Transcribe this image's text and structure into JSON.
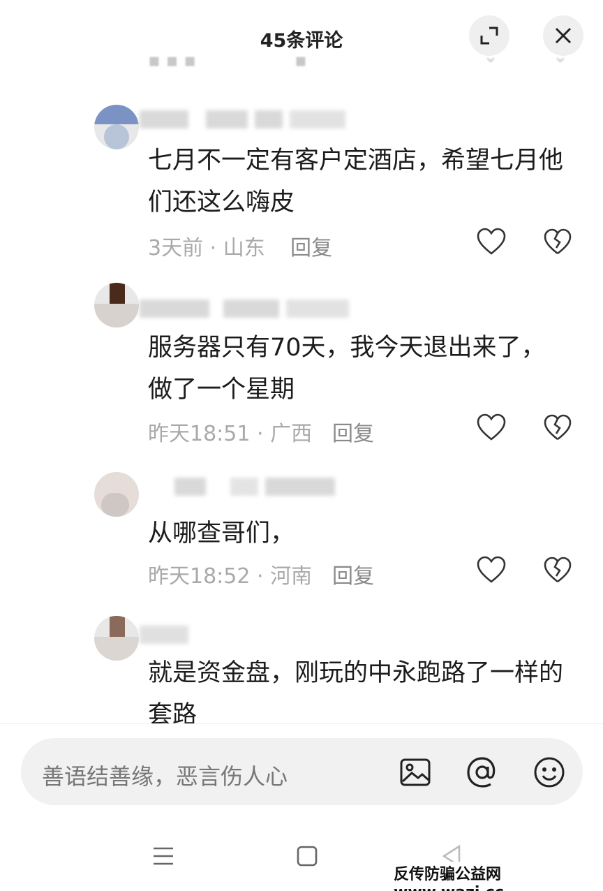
{
  "header": {
    "title": "45条评论"
  },
  "comments": [
    {
      "text_line1": "七月不一定有客户定酒店，希望七月他",
      "text_line2": "们还这么嗨皮",
      "meta": "3天前 · 山东",
      "reply": "回复"
    },
    {
      "text_line1": "服务器只有70天，我今天退出来了，",
      "text_line2": "做了一个星期",
      "meta": "昨天18:51 · 广西",
      "reply": "回复"
    },
    {
      "text_line1": "从哪查哥们，",
      "meta": "昨天18:52 · 河南",
      "reply": "回复"
    },
    {
      "text_line1": "就是资金盘，刚玩的中永跑路了一样的",
      "text_line2": "套路"
    }
  ],
  "input": {
    "placeholder": "善语结善缘，恶言伤人心"
  },
  "watermark": {
    "text": "反传防骗公益网 www.wazi.cc"
  },
  "icons": {
    "expand": "expand-icon",
    "close": "close-icon",
    "like": "heart-icon",
    "dislike": "broken-heart-icon",
    "image": "image-icon",
    "mention": "at-icon",
    "emoji": "emoji-icon",
    "menu": "menu-icon",
    "home": "square-home-icon",
    "back": "back-triangle-icon"
  },
  "colors": {
    "accent_text": "#1c1c1c",
    "meta_text": "#a9a9a9",
    "input_bg": "#f1f1f1"
  }
}
